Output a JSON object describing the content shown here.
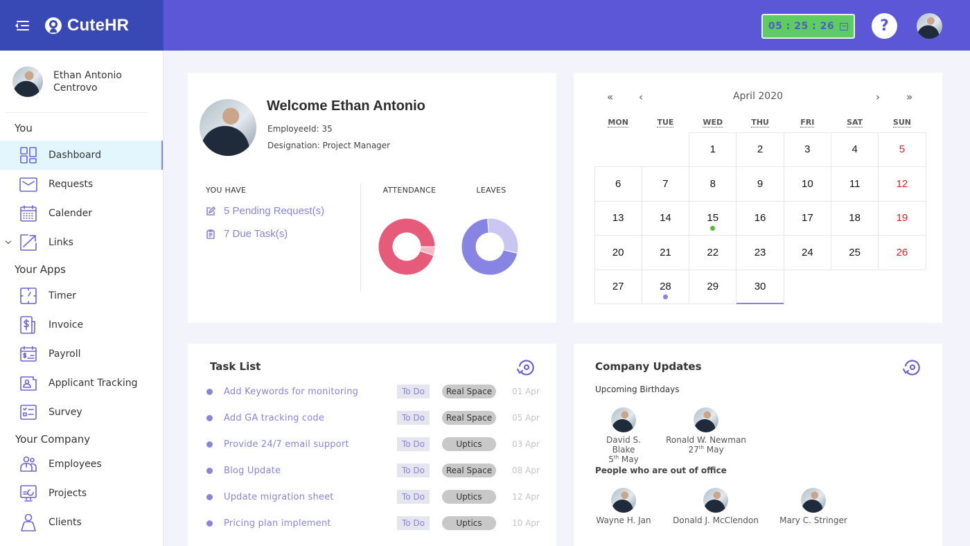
{
  "app": {
    "name": "CuteHR",
    "timer": "05 : 25 : 26",
    "help_label": "?"
  },
  "colors": {
    "brand_dark": "#3848b5",
    "brand": "#5b57d6",
    "accent": "#8884dc",
    "timer_green": "#5fcb63",
    "sunday_red": "#e01f26",
    "attendance_main": "#e65a7a",
    "attendance_secondary": "#f9b8c8",
    "leaves_main": "#8884e4",
    "leaves_secondary": "#c9c6f1"
  },
  "user": {
    "full_name": "Ethan Antonio Centrovo",
    "name_line1": "Ethan Antonio",
    "name_line2": "Centrovo"
  },
  "sidebar": {
    "sections": [
      {
        "title": "You",
        "items": [
          {
            "label": "Dashboard",
            "icon": "dashboard-icon",
            "active": true
          },
          {
            "label": "Requests",
            "icon": "envelope-icon"
          },
          {
            "label": "Calender",
            "icon": "calendar-icon"
          },
          {
            "label": "Links",
            "icon": "external-link-icon",
            "expandable": true
          }
        ]
      },
      {
        "title": "Your Apps",
        "items": [
          {
            "label": "Timer",
            "icon": "timer-icon"
          },
          {
            "label": "Invoice",
            "icon": "invoice-icon"
          },
          {
            "label": "Payroll",
            "icon": "payroll-icon"
          },
          {
            "label": "Applicant Tracking",
            "icon": "applicant-icon"
          },
          {
            "label": "Survey",
            "icon": "survey-icon"
          }
        ]
      },
      {
        "title": "Your Company",
        "items": [
          {
            "label": "Employees",
            "icon": "employees-icon"
          },
          {
            "label": "Projects",
            "icon": "projects-icon"
          },
          {
            "label": "Clients",
            "icon": "client-icon"
          }
        ]
      }
    ]
  },
  "welcome": {
    "title": "Welcome Ethan Antonio",
    "employee_id": "EmployeeId: 35",
    "designation": "Designation: Project Manager",
    "you_have_label": "YOU HAVE",
    "pending_requests": "5 Pending Request(s)",
    "due_tasks": "7 Due Task(s)",
    "attendance_label": "ATTENDANCE",
    "leaves_label": "LEAVES"
  },
  "chart_data": [
    {
      "type": "pie",
      "title": "ATTENDANCE",
      "donut": true,
      "values": [
        95,
        5
      ],
      "labels": [
        "",
        ""
      ]
    },
    {
      "type": "pie",
      "title": "LEAVES",
      "donut": true,
      "values": [
        70,
        30
      ],
      "labels": [
        "",
        ""
      ]
    }
  ],
  "calendar": {
    "title": "April 2020",
    "nav": {
      "prev_year": "«",
      "prev_month": "‹",
      "next_month": "›",
      "next_year": "»"
    },
    "weekdays": [
      "MON",
      "TUE",
      "WED",
      "THU",
      "FRI",
      "SAT",
      "SUN"
    ],
    "leading_blanks": 2,
    "days_in_month": 30,
    "today": 30,
    "events": [
      {
        "day": 15,
        "color": "#4cc431"
      },
      {
        "day": 28,
        "color": "#8884dc"
      }
    ]
  },
  "tasks": {
    "title": "Task List",
    "items": [
      {
        "name": "Add Keywords for monitoring",
        "status": "To Do",
        "project": "Real Space",
        "date": "01 Apr"
      },
      {
        "name": "Add GA tracking code",
        "status": "To Do",
        "project": "Real Space",
        "date": "05 Apr"
      },
      {
        "name": "Provide 24/7 email support",
        "status": "To Do",
        "project": "Uptics",
        "date": "03 Apr"
      },
      {
        "name": "Blog Update",
        "status": "To Do",
        "project": "Real Space",
        "date": "08 Apr"
      },
      {
        "name": "Update migration sheet",
        "status": "To Do",
        "project": "Uptics",
        "date": "12 Apr"
      },
      {
        "name": "Pricing plan implement",
        "status": "To Do",
        "project": "Uptics",
        "date": "10 Apr"
      }
    ]
  },
  "updates": {
    "title": "Company Updates",
    "birthdays_title": "Upcoming Birthdays",
    "birthdays": [
      {
        "name": "David S. Blake",
        "day": "5",
        "suffix": "th",
        "month": "May"
      },
      {
        "name": "Ronald W. Newman",
        "day": "27",
        "suffix": "th",
        "month": "May"
      }
    ],
    "ooo_title": "People who are out of office",
    "out_of_office": [
      {
        "name": "Wayne H. Jan"
      },
      {
        "name": "Donald J. McClendon"
      },
      {
        "name": "Mary C. Stringer"
      }
    ]
  }
}
